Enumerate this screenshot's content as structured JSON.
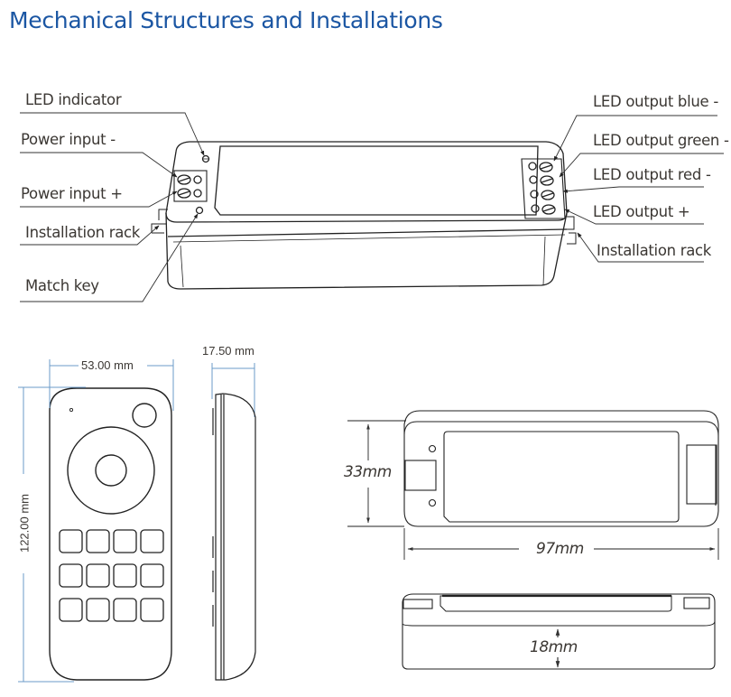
{
  "title": "Mechanical Structures and Installations",
  "callouts_left": {
    "led_indicator": "LED indicator",
    "power_input_minus": "Power input -",
    "power_input_plus": "Power input +",
    "installation_rack": "Installation rack",
    "match_key": "Match key"
  },
  "callouts_right": {
    "led_output_blue_minus": "LED output blue -",
    "led_output_green_minus": "LED output green -",
    "led_output_red_minus": "LED output red -",
    "led_output_plus": "LED output +",
    "installation_rack": "Installation rack"
  },
  "remote_dimensions": {
    "width": "53.00 mm",
    "thickness": "17.50 mm",
    "height": "122.00 mm"
  },
  "controller_dimensions": {
    "height": "33mm",
    "length": "97mm",
    "depth": "18mm"
  },
  "remote_button_grid": {
    "rows": 3,
    "columns": 4
  },
  "colors": {
    "title": "#1b56a3",
    "label_text": "#3b3733",
    "dimension_line": "#6b9bc8",
    "drawing_line": "#222222"
  }
}
